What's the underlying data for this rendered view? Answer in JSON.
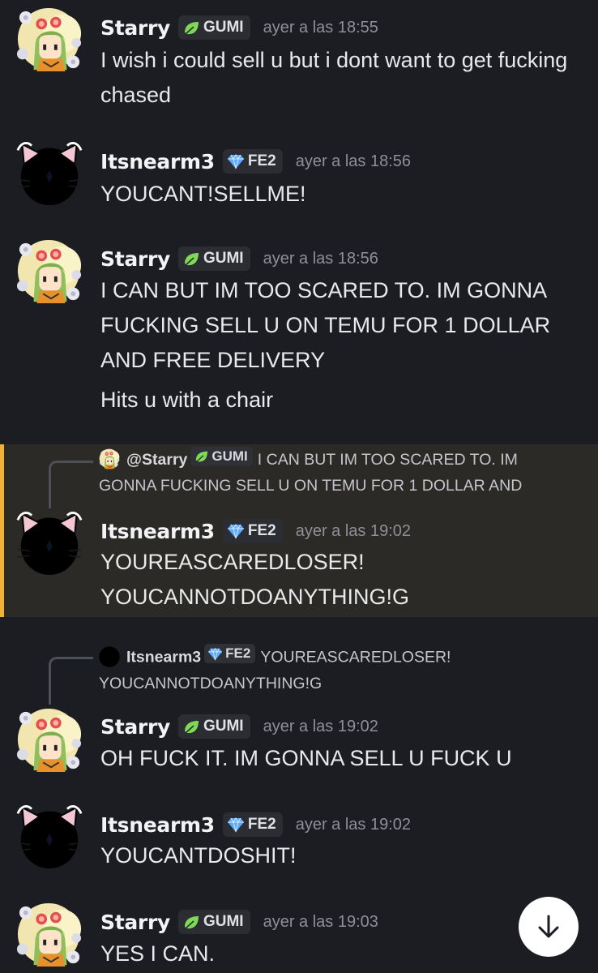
{
  "messages": [
    {
      "author": "Starry",
      "tag": "GUMI",
      "time": "ayer a las 18:55",
      "lines": [
        "I wish i could sell u but i dont want to get fucking chased"
      ]
    },
    {
      "author": "Itsnearm3",
      "tag": "FE2",
      "time": "ayer a las 18:56",
      "lines": [
        "YOUCANT!SELLME!"
      ]
    },
    {
      "author": "Starry",
      "tag": "GUMI",
      "time": "ayer a las 18:56",
      "lines": [
        "I CAN BUT IM TOO SCARED TO. IM GONNA FUCKING SELL U ON TEMU FOR 1 DOLLAR AND FREE DELIVERY",
        "Hits u with a chair"
      ]
    },
    {
      "author": "Itsnearm3",
      "tag": "FE2",
      "time": "ayer a las 19:02",
      "lines": [
        "YOUREASCAREDLOSER! YOUCANNOTDOANYTHING!G"
      ],
      "reply": {
        "author": "@Starry",
        "tag": "GUMI",
        "text": "I CAN BUT IM TOO SCARED TO. IM GONNA FUCKING SELL U ON TEMU FOR 1 DOLLAR AND"
      }
    },
    {
      "author": "Starry",
      "tag": "GUMI",
      "time": "ayer a las 19:02",
      "lines": [
        "OH FUCK IT. IM GONNA SELL U FUCK U"
      ],
      "reply": {
        "author": "Itsnearm3",
        "tag": "FE2",
        "text": "YOUREASCAREDLOSER! YOUCANNOTDOANYTHING!G"
      }
    },
    {
      "author": "Itsnearm3",
      "tag": "FE2",
      "time": "ayer a las 19:02",
      "lines": [
        "YOUCANTDOSHIT!"
      ]
    },
    {
      "author": "Starry",
      "tag": "GUMI",
      "time": "ayer a las 19:03",
      "lines": [
        "YES I CAN."
      ]
    }
  ],
  "icons": {
    "gumi_tag": "leaf-icon",
    "fe2_tag": "diamond-icon",
    "scroll": "arrow-down-icon"
  },
  "colors": {
    "background": "#1c1d22",
    "highlight": "#2c2a27",
    "highlight_bar": "#f0b232",
    "leaf": "#7ed957",
    "diamond": "#5aa8ff"
  }
}
